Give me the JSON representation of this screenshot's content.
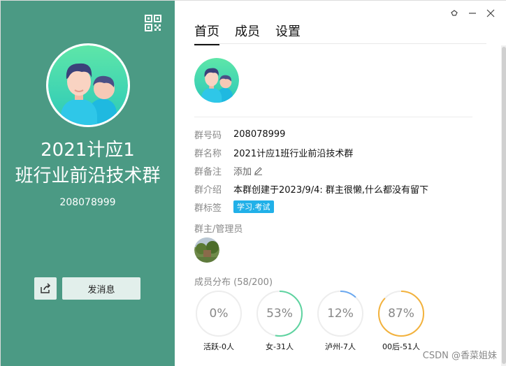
{
  "left": {
    "group_name": "2021计应1班行业前沿技术群",
    "group_id": "208078999",
    "send_label": "发消息",
    "bg_color": "#4b9a84"
  },
  "right": {
    "tabs": [
      {
        "label": "首页",
        "active": true
      },
      {
        "label": "成员",
        "active": false
      },
      {
        "label": "设置",
        "active": false
      }
    ],
    "info": {
      "number_label": "群号码",
      "number_value": "208078999",
      "name_label": "群名称",
      "name_value": "2021计应1班行业前沿技术群",
      "remark_label": "群备注",
      "remark_value": "添加",
      "intro_label": "群介绍",
      "intro_value": "本群创建于2023/9/4:  群主很懒,什么都没有留下",
      "tag_label": "群标签",
      "tag_value": "学习.考试"
    },
    "admins_title": "群主/管理员",
    "distribution_title": "成员分布 (58/200)",
    "distribution": [
      {
        "percent": "0%",
        "value": 0,
        "label": "活跃-0人",
        "color": "#ededed"
      },
      {
        "percent": "53%",
        "value": 53,
        "label": "女-31人",
        "color": "#5ed3a0"
      },
      {
        "percent": "12%",
        "value": 12,
        "label": "泸州-7人",
        "color": "#6aa8f0"
      },
      {
        "percent": "87%",
        "value": 87,
        "label": "00后-51人",
        "color": "#f3b23c"
      }
    ]
  },
  "watermark": "CSDN @香菜姐妹"
}
